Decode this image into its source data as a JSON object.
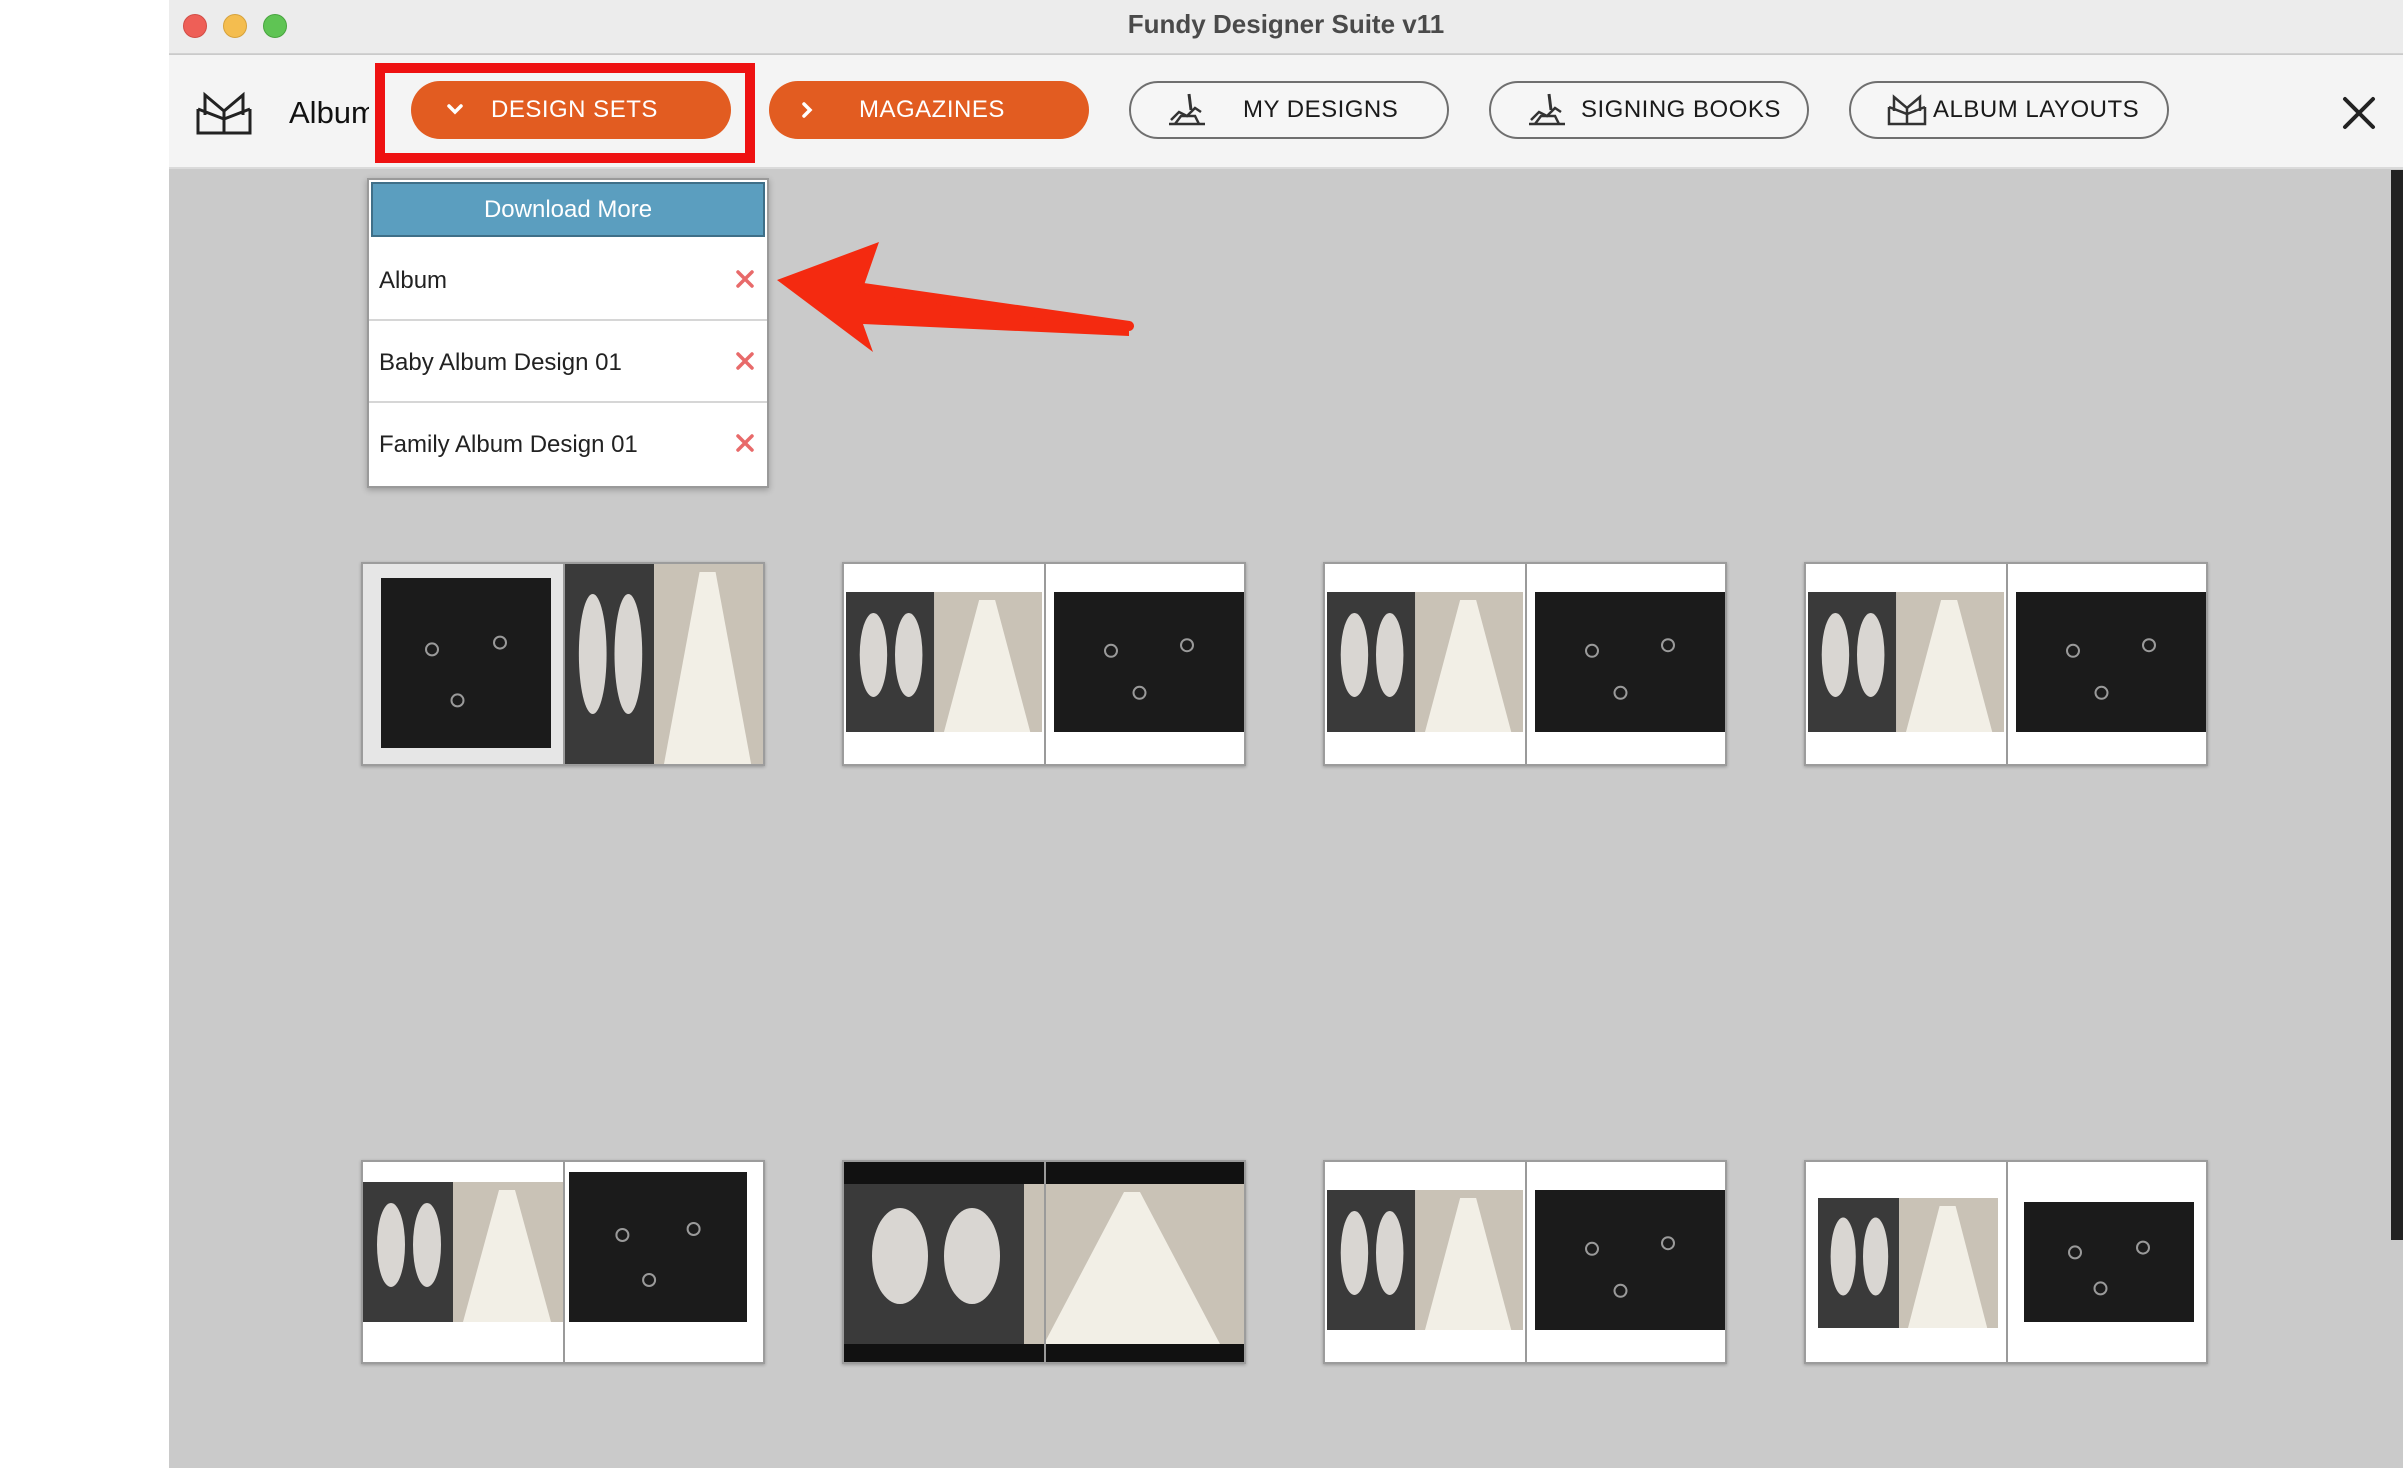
{
  "window": {
    "title": "Fundy Designer Suite v11"
  },
  "toolbar": {
    "album_title": "Album",
    "buttons": {
      "design_sets": "DESIGN SETS",
      "magazines": "MAGAZINES",
      "my_designs": "MY DESIGNS",
      "signing_books": "SIGNING BOOKS",
      "album_layouts": "ALBUM LAYOUTS"
    },
    "icons": {
      "album": "open-book-icon",
      "design_sets": "chevron-down-icon",
      "magazines": "chevron-right-icon",
      "my_designs": "hand-pen-icon",
      "signing_books": "hand-pen-icon",
      "album_layouts": "open-book-icon",
      "close": "close-icon"
    }
  },
  "dropdown": {
    "download_label": "Download More",
    "items": [
      {
        "label": "Album"
      },
      {
        "label": "Baby Album Design 01"
      },
      {
        "label": "Family Album Design 01"
      }
    ],
    "remove_icon": "x-icon"
  },
  "thumbnails": {
    "count": 8,
    "content": "album spread previews: black fabric with rings, jeweled shoes, wedding dress"
  },
  "colors": {
    "accent_orange": "#e25c21",
    "download_blue": "#5b9ebf",
    "highlight_red": "#ee1111",
    "remove_red": "#e86a6a"
  }
}
